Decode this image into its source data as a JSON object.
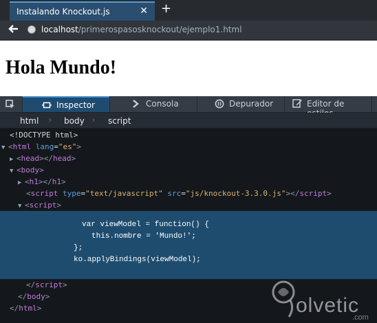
{
  "browser": {
    "tab_title": "Instalando Knockout.js",
    "tab_close_icon": "close-icon",
    "new_tab_icon": "plus-icon",
    "back_icon": "arrow-left-icon",
    "site_icon": "globe-icon",
    "url_host": "localhost",
    "url_path": "/primerospasosknockout/ejemplo1.html"
  },
  "page": {
    "heading": "Hola Mundo!"
  },
  "devtools": {
    "picker_icon": "element-picker-icon",
    "tabs": [
      {
        "label": "Inspector",
        "icon": "inspector-icon",
        "active": true
      },
      {
        "label": "Consola",
        "icon": "console-icon",
        "active": false
      },
      {
        "label": "Depurador",
        "icon": "debugger-icon",
        "active": false
      },
      {
        "label": "Editor de estilos",
        "icon": "style-editor-icon",
        "active": false
      }
    ],
    "breadcrumbs": [
      "html",
      "body",
      "script"
    ],
    "colors": {
      "tag": "#c678dd",
      "attr_name": "#5c9ed6",
      "attr_value": "#d9b170",
      "selection": "#1e4c6e",
      "active_tab": "#1f4b70"
    },
    "markup": {
      "doctype": "<!DOCTYPE html>",
      "html_open_tag": "html",
      "html_lang_attr": "lang",
      "html_lang_value": "\"es\"",
      "head_tag": "head",
      "body_tag": "body",
      "h1_tag": "h1",
      "script_tag": "script",
      "script_type_attr": "type",
      "script_type_value": "\"text/javascript\"",
      "script_src_attr": "src",
      "script_src_value": "\"js/knockout-3.3.0.js\"",
      "code_lines": [
        "var viewModel = function() {",
        "this.nombre = 'Mundo!';",
        "};",
        "ko.applyBindings(viewModel);"
      ]
    }
  },
  "watermark": {
    "brand": "olvetic",
    "suffix": ".com"
  }
}
